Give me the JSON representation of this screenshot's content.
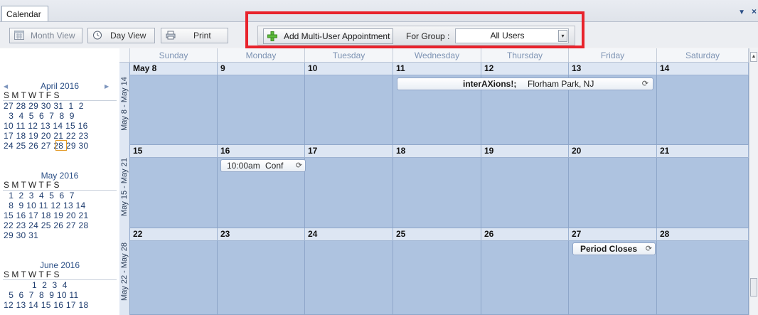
{
  "window": {
    "tab_title": "Calendar",
    "pin_glyph": "▼",
    "close_glyph": "×"
  },
  "toolbar": {
    "month_view_label": "Month View",
    "day_view_label": "Day View",
    "print_label": "Print",
    "add_multi_label": "Add Multi-User Appointment",
    "for_group_label": "For Group :",
    "group_value": "All Users"
  },
  "day_names": [
    "Sunday",
    "Monday",
    "Tuesday",
    "Wednesday",
    "Thursday",
    "Friday",
    "Saturday"
  ],
  "mini_calendars": [
    {
      "title": "April 2016",
      "days_header": "S  M  T  W  T  F  S",
      "rows": [
        "27 28 29 30 31  1  2",
        "  3  4  5  6  7  8  9",
        "10 11 12 13 14 15 16",
        "17 18 19 20 21 22 23",
        "24 25 26 27 28 29 30"
      ]
    },
    {
      "title": "May 2016",
      "days_header": "S  M  T  W  T  F  S",
      "rows": [
        "  1  2  3  4  5  6  7",
        "  8  9 10 11 12 13 14",
        "15 16 17 18 19 20 21",
        "22 23 24 25 26 27 28",
        "29 30 31"
      ]
    },
    {
      "title": "June 2016",
      "days_header": "S  M  T  W  T  F  S",
      "rows": [
        "           1  2  3  4",
        "  5  6  7  8  9 10 11",
        "12 13 14 15 16 17 18"
      ]
    }
  ],
  "weeks": [
    {
      "label": "May 8 - May 14",
      "dates": [
        "May 8",
        "9",
        "10",
        "11",
        "12",
        "13",
        "14"
      ]
    },
    {
      "label": "May 15 - May 21",
      "dates": [
        "15",
        "16",
        "17",
        "18",
        "19",
        "20",
        "21"
      ]
    },
    {
      "label": "May 22 - May 28",
      "dates": [
        "22",
        "23",
        "24",
        "25",
        "26",
        "27",
        "28"
      ]
    }
  ],
  "appointments": {
    "interaxions": {
      "title": "interAXions!;",
      "location": "Florham Park, NJ"
    },
    "conf": {
      "time": "10:00am",
      "title": "Conf"
    },
    "period": {
      "title": "Period Closes"
    }
  },
  "recurrence_glyph": "⟳"
}
